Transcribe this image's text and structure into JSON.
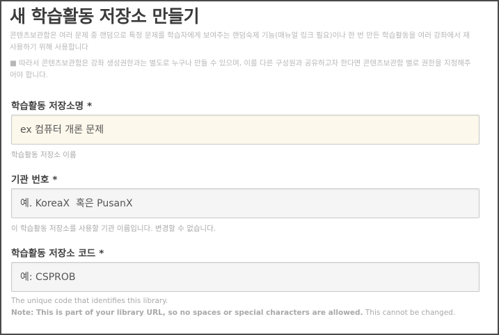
{
  "page": {
    "title": "새 학습활동 저장소 만들기"
  },
  "intro": {
    "line1": "콘텐츠보관함은 여러 문제 중 랜덤으로 특정 문제를 학습자에게 보여주는 랜덤숙제 기능(매뉴얼 링크 필요)이나 한 번 만든 학습활동을 여러 강좌에서 재",
    "line2": "사용하기 위해 사용합니다",
    "line3": "■ 따라서 콘텐츠보관함은 강좌 생성권한과는 별도로 누구나 만들 수 있으며, 이를 다른 구성원과 공유하고자 한다면 콘텐츠보관함 별로 권한을 지정해주",
    "line4": "어야 합니다."
  },
  "form": {
    "library_name": {
      "label": "학습활동 저장소명",
      "required_mark": "*",
      "placeholder": "ex 컴퓨터 개론 문제",
      "value": "",
      "helper": "학습활동 저장소 이름"
    },
    "org": {
      "label": "기관 번호",
      "required_mark": "*",
      "placeholder": "예. KoreaX  혹은 PusanX",
      "value": "",
      "helper": "이 학습활동 저장소를 사용할 기관 이름입니다. 변경할 수 없습니다."
    },
    "library_code": {
      "label": "학습활동 저장소 코드",
      "required_mark": "*",
      "placeholder": "예: CSPROB",
      "value": "",
      "helper_line1": "The unique code that identifies this library.",
      "helper_note": "Note: This is part of your library URL, so no spaces or special characters are allowed.",
      "helper_tail": " This cannot be changed."
    }
  }
}
